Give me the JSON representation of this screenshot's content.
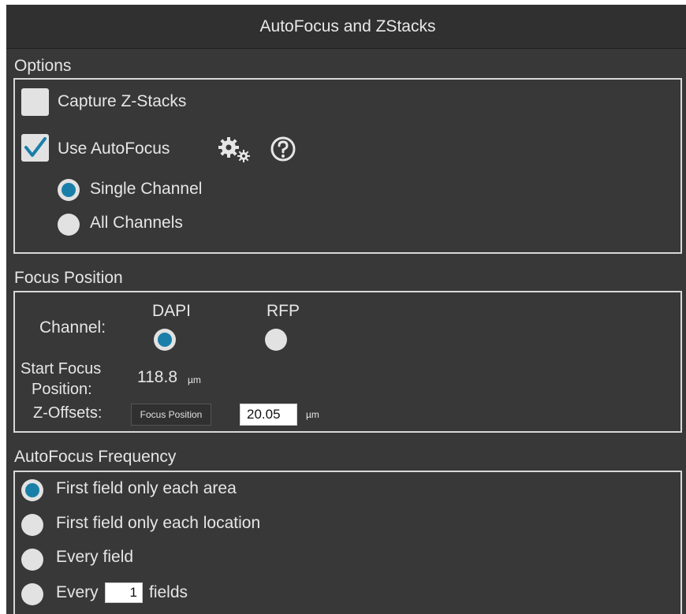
{
  "window": {
    "title": "AutoFocus and ZStacks"
  },
  "options": {
    "label": "Options",
    "capture_zstacks": {
      "label": "Capture Z-Stacks",
      "checked": false
    },
    "use_autofocus": {
      "label": "Use AutoFocus",
      "checked": true
    },
    "channel_mode": {
      "items": [
        {
          "label": "Single Channel",
          "selected": true
        },
        {
          "label": "All Channels",
          "selected": false
        }
      ]
    },
    "icons": [
      "gear-icon",
      "help-icon"
    ]
  },
  "focus_position": {
    "label": "Focus Position",
    "channel_label": "Channel:",
    "channels": [
      {
        "label": "DAPI",
        "selected": true
      },
      {
        "label": "RFP",
        "selected": false
      }
    ],
    "start_focus_label_line1": "Start Focus",
    "start_focus_label_line2": "Position:",
    "start_focus_value": "118.8",
    "start_focus_unit": "µm",
    "zoffsets_label": "Z-Offsets:",
    "zoffsets_button": "Focus Position",
    "zoffsets_value": "20.05",
    "zoffsets_unit": "µm"
  },
  "autofocus_frequency": {
    "label": "AutoFocus Frequency",
    "items": [
      {
        "label": "First field only each area",
        "selected": true
      },
      {
        "label": "First field only each location",
        "selected": false
      },
      {
        "label": "Every field",
        "selected": false
      }
    ],
    "every_n": {
      "prefix": "Every",
      "value": "1",
      "suffix": "fields",
      "selected": false
    }
  },
  "colors": {
    "background": "#383838",
    "accent": "#1a7fa8",
    "border": "#d8d8d8"
  }
}
